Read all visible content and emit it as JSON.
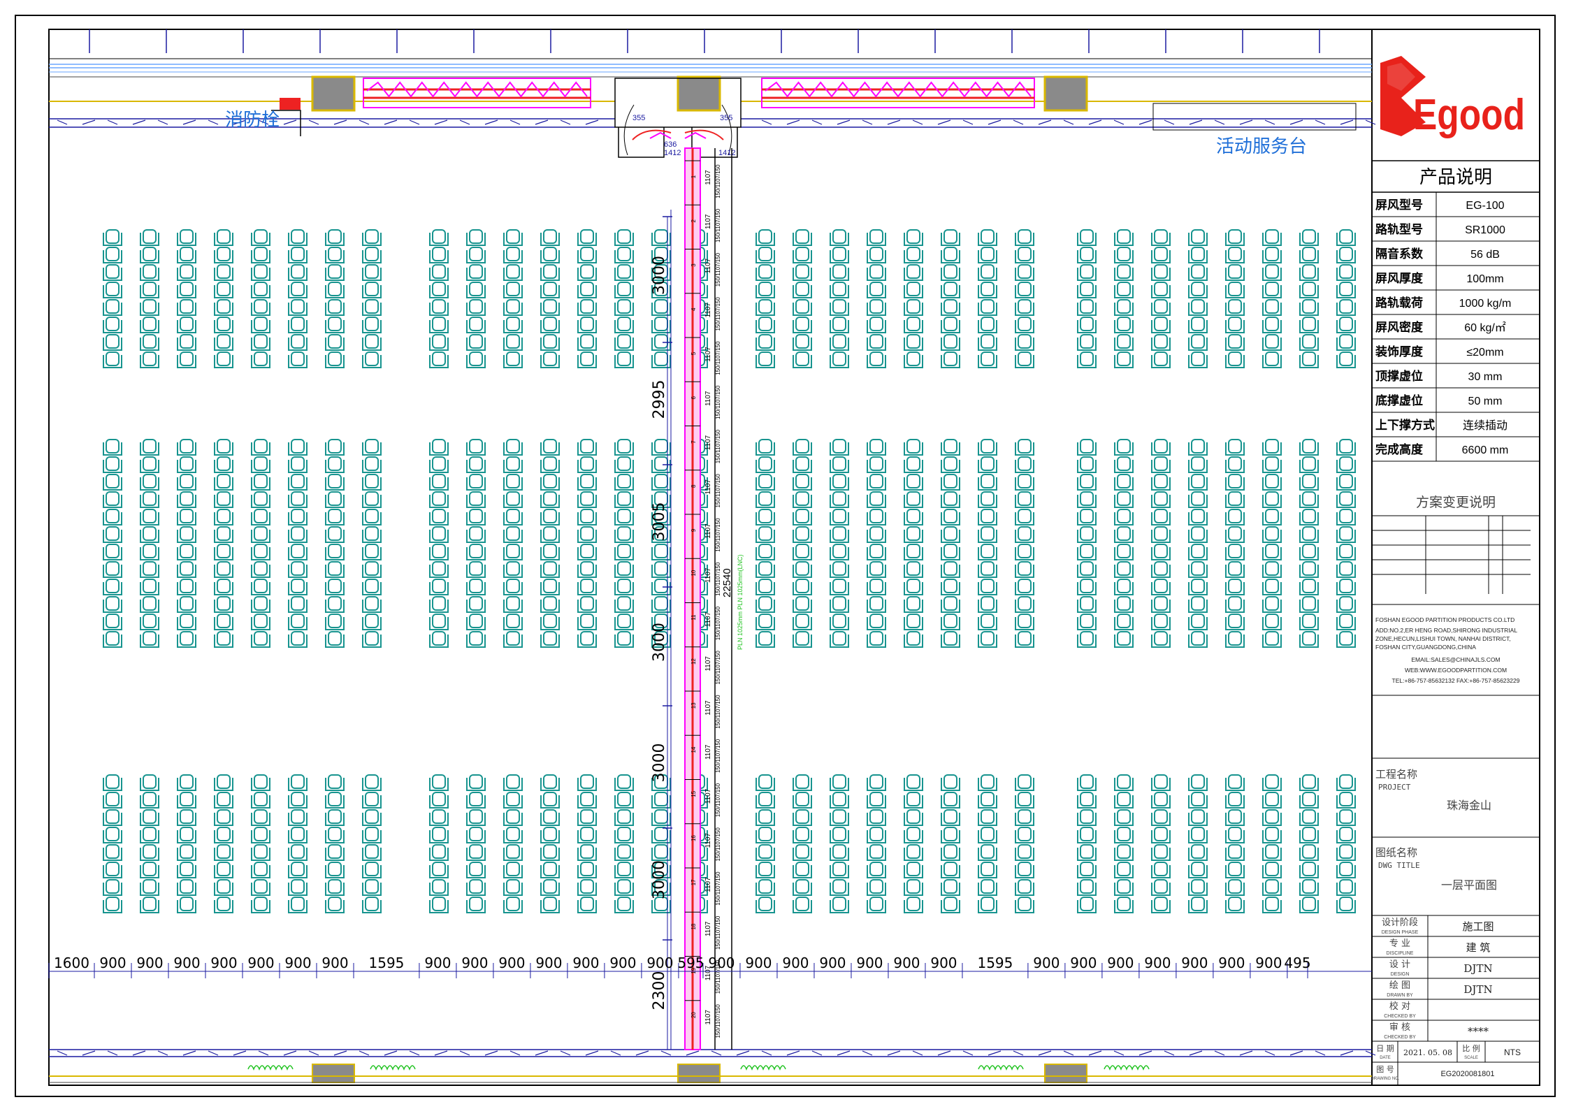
{
  "room_labels": {
    "hydrant": "消防栓",
    "service_desk": "活动服务台"
  },
  "logo": {
    "text": "Egood",
    "color": "#e8221b"
  },
  "colors": {
    "seat": "#17948f",
    "track_magenta": "#ff00ff",
    "track_red": "#ee2222",
    "dimension_blue": "#1a1aa0",
    "label_blue": "#1f6fd8",
    "wall_gray": "#8a8a8a",
    "green_detail": "#22c322"
  },
  "product_info": {
    "heading": "产品说明",
    "rows": [
      {
        "label": "屏风型号",
        "value": "EG-100"
      },
      {
        "label": "路轨型号",
        "value": "SR1000"
      },
      {
        "label": "隔音系数",
        "value": "56 dB"
      },
      {
        "label": "屏风厚度",
        "value": "100mm"
      },
      {
        "label": "路轨载荷",
        "value": "1000 kg/m"
      },
      {
        "label": "屏风密度",
        "value": "60 kg/㎡"
      },
      {
        "label": "装饰厚度",
        "value": "≤20mm"
      },
      {
        "label": "顶撑虚位",
        "value": "30 mm"
      },
      {
        "label": "底撑虚位",
        "value": "50 mm"
      },
      {
        "label": "上下撑方式",
        "value": "连续插动"
      },
      {
        "label": "完成高度",
        "value": "6600 mm"
      }
    ]
  },
  "change_notes": {
    "heading": "方案变更说明"
  },
  "company": {
    "name": "FOSHAN EGOOD PARTITION PRODUCTS CO.LTD",
    "address_1": "ADD:NO.2,ER HENG ROAD,SHIRONG INDUSTRIAL",
    "address_2": "ZONE,HECUN,LISHUI TOWN, NANHAI DISTRICT,",
    "address_3": "FOSHAN CITY,GUANGDONG,CHINA",
    "email": "EMAIL:SALES@CHINAJLS.COM",
    "web": "WEB:WWW.EGOODPARTITION.COM",
    "tel": "TEL:+86-757-85632132  FAX:+86-757-85623229"
  },
  "project": {
    "label_cn": "工程名称",
    "label_en": "PROJECT",
    "value": "珠海金山"
  },
  "drawing_title": {
    "label_cn": "图纸名称",
    "label_en": "DWG TITLE",
    "value": "一层平面图"
  },
  "design_phase": {
    "label_cn": "设计阶段",
    "label_en": "DESIGN PHASE",
    "value": "施工图"
  },
  "discipline": {
    "label_cn": "专 业",
    "label_en": "DISCIPLINE",
    "value": "建 筑"
  },
  "designed_by": {
    "label_cn": "设 计",
    "label_en": "DESIGN",
    "value": "DJTN"
  },
  "drawn_by": {
    "label_cn": "绘 图",
    "label_en": "DRAWN BY",
    "value": "DJTN"
  },
  "checked_by": {
    "label_cn": "校 对",
    "label_en": "CHECKED BY",
    "value": ""
  },
  "approved_by": {
    "label_cn": "审 核",
    "label_en": "CHECKED BY",
    "value": "****"
  },
  "date": {
    "label_cn": "日 期",
    "label_en": "DATE",
    "value": "2021. 05. 08"
  },
  "scale": {
    "label_cn": "比 例",
    "label_en": "SCALE",
    "value": "NTS"
  },
  "drawing_no": {
    "label_cn": "图 号",
    "label_en": "DRAWING NO.",
    "value": "EG2020081801"
  },
  "dimensions": {
    "horizontal": [
      "1600",
      "900",
      "900",
      "900",
      "900",
      "900",
      "900",
      "900",
      "1595",
      "900",
      "900",
      "900",
      "900",
      "900",
      "900",
      "900",
      "595",
      "900",
      "900",
      "900",
      "900",
      "900",
      "900",
      "900",
      "1595",
      "900",
      "900",
      "900",
      "900",
      "900",
      "900",
      "900",
      "495"
    ],
    "vertical": [
      "3000",
      "2995",
      "3005",
      "3000",
      "3000",
      "3000",
      "2300"
    ],
    "total_length": "22540",
    "panel_label_1": "1107",
    "panel_label_2": "150/1107/150",
    "panel_counts": [
      "1",
      "2",
      "3",
      "4",
      "5",
      "6",
      "7",
      "8",
      "9",
      "10",
      "11",
      "12",
      "13",
      "14",
      "15",
      "16",
      "17",
      "18",
      "19",
      "20"
    ],
    "green_note": "PLN 1025mm PLN 1025mm(LNC)",
    "door_dims": [
      "636",
      "1412",
      "1412",
      "355",
      "355"
    ]
  }
}
